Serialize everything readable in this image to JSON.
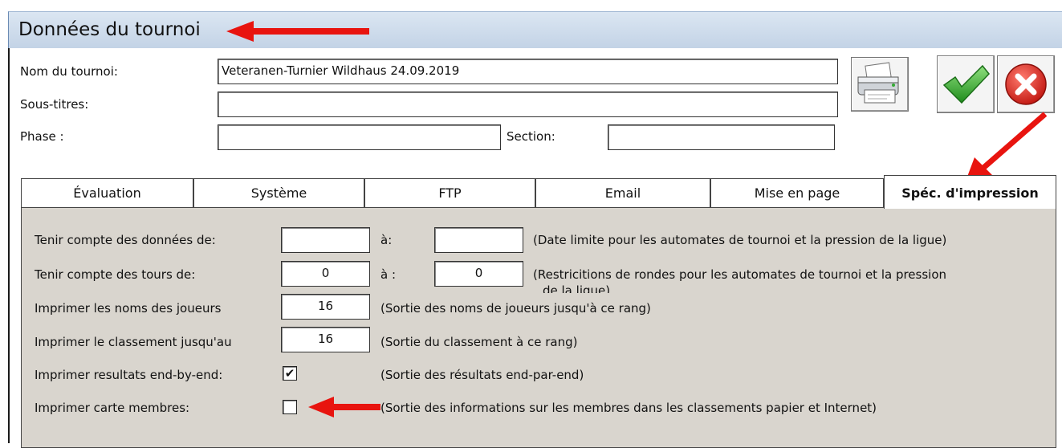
{
  "window": {
    "title": "Données du tournoi"
  },
  "form": {
    "name_label": "Nom du tournoi:",
    "name_value": "Veteranen-Turnier Wildhaus 24.09.2019",
    "subtitle_label": "Sous-titres:",
    "subtitle_value": "",
    "phase_label": "Phase :",
    "phase_value": "",
    "section_label": "Section:",
    "section_value": ""
  },
  "toolbar": {
    "print_icon": "printer-icon",
    "ok_icon": "checkmark-icon",
    "cancel_icon": "cancel-icon"
  },
  "tabs": [
    {
      "label": "Évaluation",
      "active": false
    },
    {
      "label": "Système",
      "active": false
    },
    {
      "label": "FTP",
      "active": false
    },
    {
      "label": "Email",
      "active": false
    },
    {
      "label": "Mise en page",
      "active": false
    },
    {
      "label": "Spéc. d'impression",
      "active": true
    }
  ],
  "panel": {
    "row1": {
      "label": "Tenir compte des données de:",
      "from_value": "",
      "to_label": "à:",
      "to_value": "",
      "hint": "(Date limite pour les automates de tournoi et la pression de la ligue)"
    },
    "row2": {
      "label": "Tenir compte des tours de:",
      "from_value": "0",
      "to_label": "à :",
      "to_value": "0",
      "hint_line1": "(Restricitions de rondes pour les automates de tournoi et la pression",
      "hint_line2": "de la ligue)"
    },
    "row3": {
      "label": "Imprimer les noms des joueurs",
      "value": "16",
      "hint": "(Sortie des noms de joueurs jusqu'à ce rang)"
    },
    "row4": {
      "label": "Imprimer le classement jusqu'au",
      "value": "16",
      "hint": "(Sortie du classement à ce rang)"
    },
    "row5": {
      "label": "Imprimer resultats end-by-end:",
      "checked": true,
      "check_glyph": "✔",
      "hint": "(Sortie des résultats end-par-end)"
    },
    "row6": {
      "label": "Imprimer carte membres:",
      "checked": false,
      "hint": "(Sortie des informations sur les membres dans les classements papier et Internet)"
    }
  },
  "colors": {
    "accent_arrow": "#e8140f",
    "panel_bg": "#d9d5ce",
    "ok_green": "#2fa82a",
    "cancel_red": "#d8221b"
  }
}
